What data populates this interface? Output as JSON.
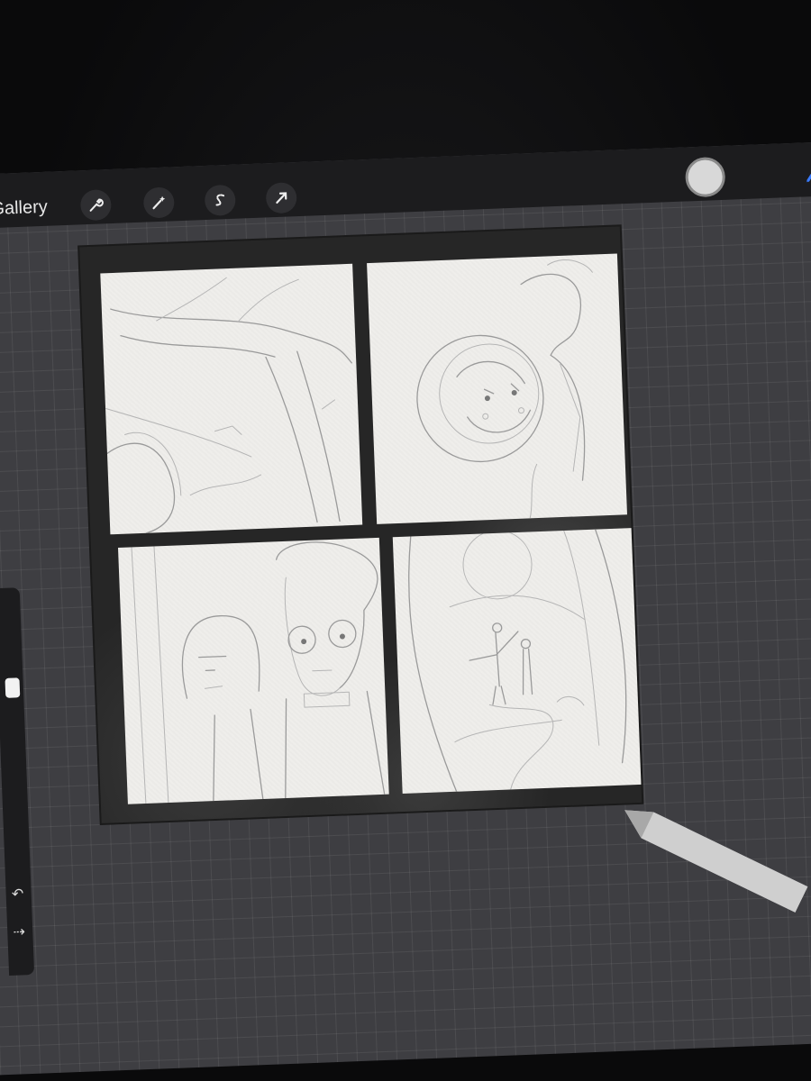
{
  "toolbar": {
    "gallery_label": "Gallery",
    "tools": [
      {
        "name": "wrench-icon"
      },
      {
        "name": "magic-wand-icon"
      },
      {
        "name": "selection-s-icon"
      },
      {
        "name": "move-arrow-icon"
      }
    ],
    "current_color": "#d8d8d8",
    "brush_tool": "brush-icon"
  },
  "sidebar": {
    "undo_icon": "undo-icon",
    "redo_icon": "redo-icon"
  },
  "canvas": {
    "panels": [
      "panel-forest-tree",
      "panel-girl-close-up",
      "panel-two-characters",
      "panel-figures-on-path"
    ]
  },
  "colors": {
    "canvas_border": "#262626",
    "panel_paper": "#efeeeb",
    "background_grid": "#3e3e42"
  }
}
